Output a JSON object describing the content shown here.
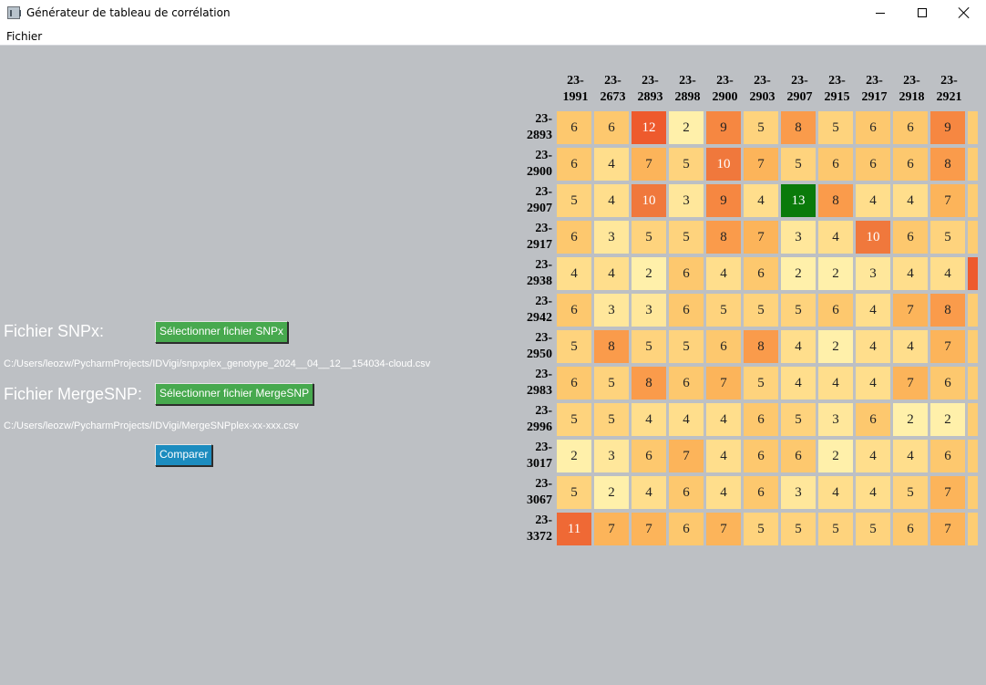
{
  "window": {
    "title": "Générateur de tableau de corrélation"
  },
  "menu": {
    "items": [
      "Fichier"
    ]
  },
  "form": {
    "snpx_label": "Fichier SNPx:",
    "snpx_button": "Sélectionner fichier SNPx",
    "snpx_path": "C:/Users/leozw/PycharmProjects/IDVigi/snpxplex_genotype_2024__04__12__154034-cloud.csv",
    "merge_label": "Fichier MergeSNP:",
    "merge_button": "Sélectionner fichier MergeSNP",
    "merge_path": "C:/Users/leozw/PycharmProjects/IDVigi/MergeSNPplex-xx-xxx.csv",
    "compare_button": "Comparer"
  },
  "colors": {
    "background": "#bdc0c4",
    "button_green": "#47a94e",
    "button_blue": "#1c8cbf",
    "max_highlight": "#0a7a0a"
  },
  "chart_data": {
    "type": "heatmap",
    "columns": [
      "23-\n1991",
      "23-\n2673",
      "23-\n2893",
      "23-\n2898",
      "23-\n2900",
      "23-\n2903",
      "23-\n2907",
      "23-\n2915",
      "23-\n2917",
      "23-\n2918",
      "23-\n2921"
    ],
    "rows": [
      "23-\n2893",
      "23-\n2900",
      "23-\n2907",
      "23-\n2917",
      "23-\n2938",
      "23-\n2942",
      "23-\n2950",
      "23-\n2983",
      "23-\n2996",
      "23-\n3017",
      "23-\n3067",
      "23-\n3372"
    ],
    "values": [
      [
        6,
        6,
        12,
        2,
        9,
        5,
        8,
        5,
        6,
        6,
        9
      ],
      [
        6,
        4,
        7,
        5,
        10,
        7,
        5,
        6,
        6,
        6,
        8
      ],
      [
        5,
        4,
        10,
        3,
        9,
        4,
        13,
        8,
        4,
        4,
        7
      ],
      [
        6,
        3,
        5,
        5,
        8,
        7,
        3,
        4,
        10,
        6,
        5
      ],
      [
        4,
        4,
        2,
        6,
        4,
        6,
        2,
        2,
        3,
        4,
        4
      ],
      [
        6,
        3,
        3,
        6,
        5,
        5,
        5,
        6,
        4,
        7,
        8
      ],
      [
        5,
        8,
        5,
        5,
        6,
        8,
        4,
        2,
        4,
        4,
        7
      ],
      [
        6,
        5,
        8,
        6,
        7,
        5,
        4,
        4,
        4,
        7,
        6
      ],
      [
        5,
        5,
        4,
        4,
        4,
        6,
        5,
        3,
        6,
        2,
        2
      ],
      [
        2,
        3,
        6,
        7,
        4,
        6,
        6,
        2,
        4,
        4,
        6
      ],
      [
        5,
        2,
        4,
        6,
        4,
        6,
        3,
        4,
        4,
        5,
        7
      ],
      [
        11,
        7,
        7,
        6,
        7,
        5,
        5,
        5,
        5,
        6,
        7
      ]
    ],
    "highlight": {
      "row": 2,
      "col": 6
    }
  }
}
